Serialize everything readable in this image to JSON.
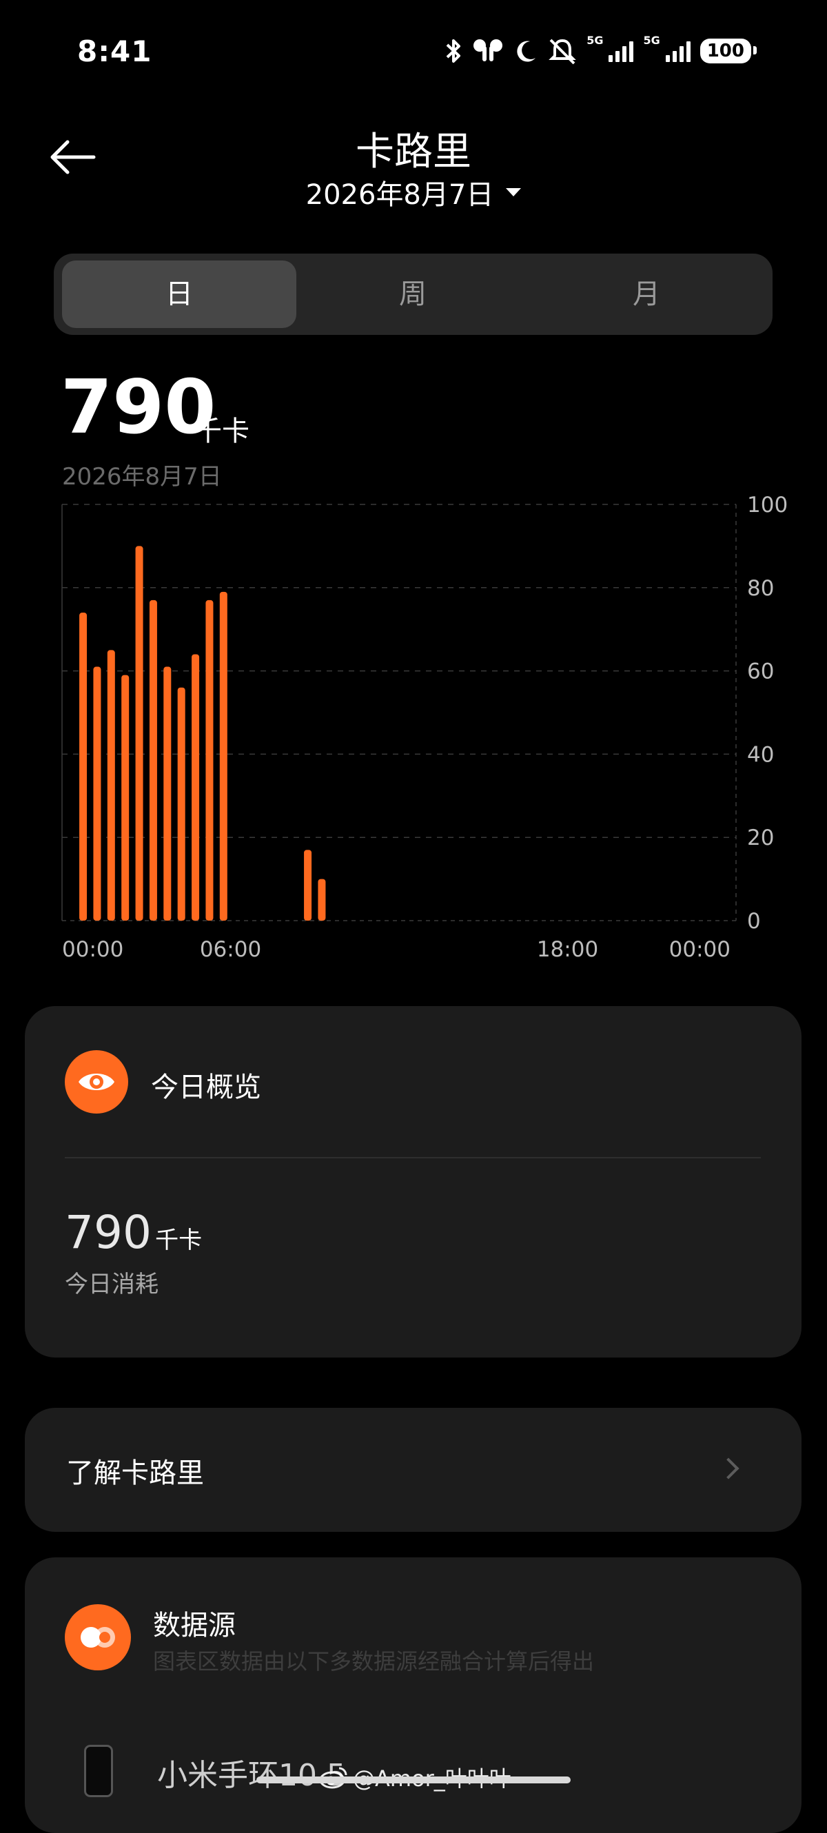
{
  "status": {
    "time": "8:41",
    "net1": "5G",
    "net2": "5G",
    "battery": "100",
    "icons": [
      "bluetooth-icon",
      "earbuds-icon",
      "moon-icon",
      "mute-bell-icon",
      "signal-icon",
      "signal-icon"
    ]
  },
  "header": {
    "title": "卡路里",
    "date": "2026年8月7日"
  },
  "tabs": [
    {
      "label": "日",
      "active": true
    },
    {
      "label": "周",
      "active": false
    },
    {
      "label": "月",
      "active": false
    }
  ],
  "summary": {
    "value": "790",
    "unit": "千卡",
    "date": "2026年8月7日"
  },
  "chart_data": {
    "type": "bar",
    "x_tick_labels": [
      "00:00",
      "06:00",
      "18:00",
      "00:00"
    ],
    "y_tick_labels": [
      "100",
      "80",
      "60",
      "40",
      "20",
      "0"
    ],
    "ylim": [
      0,
      100
    ],
    "xlim_hours": [
      0,
      24
    ],
    "grid": true,
    "bar_color": "#ff6a1f",
    "bars": [
      {
        "hour": 0.75,
        "value": 74
      },
      {
        "hour": 1.25,
        "value": 61
      },
      {
        "hour": 1.75,
        "value": 65
      },
      {
        "hour": 2.25,
        "value": 59
      },
      {
        "hour": 2.75,
        "value": 90
      },
      {
        "hour": 3.25,
        "value": 77
      },
      {
        "hour": 3.75,
        "value": 61
      },
      {
        "hour": 4.25,
        "value": 56
      },
      {
        "hour": 4.75,
        "value": 64
      },
      {
        "hour": 5.25,
        "value": 77
      },
      {
        "hour": 5.75,
        "value": 79
      },
      {
        "hour": 8.75,
        "value": 17
      },
      {
        "hour": 9.25,
        "value": 10
      }
    ]
  },
  "overview": {
    "title": "今日概览",
    "value": "790",
    "unit": "千卡",
    "label": "今日消耗",
    "icon": "eye-icon"
  },
  "learn": {
    "label": "了解卡路里"
  },
  "datasource": {
    "title": "数据源",
    "desc": "图表区数据由以下多数据源经融合计算后得出",
    "device": "小米手环10 5",
    "icon": "data-source-icon"
  },
  "watermark": "@Amor_叶叶叶",
  "colors": {
    "accent": "#ff6a1f",
    "background": "#000000",
    "card": "#1c1c1c"
  }
}
